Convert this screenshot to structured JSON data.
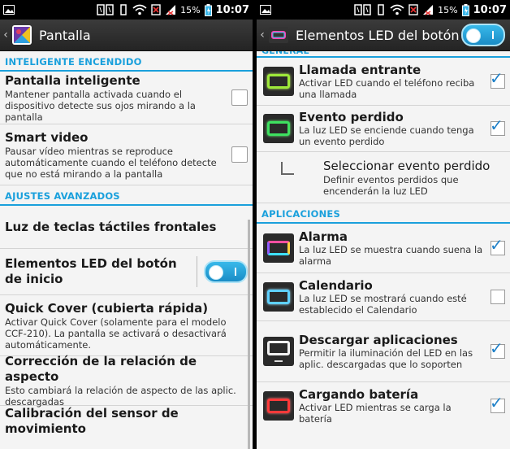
{
  "left": {
    "status": {
      "battery_pct": "15%",
      "time": "10:07"
    },
    "header": {
      "title": "Pantalla"
    },
    "sections": {
      "smart": "INTELIGENTE ENCENDIDO",
      "advanced": "AJUSTES AVANZADOS"
    },
    "items": {
      "smart_screen": {
        "title": "Pantalla inteligente",
        "desc": "Mantener pantalla activada cuando el dispositivo detecte sus ojos mirando a la pantalla"
      },
      "smart_video": {
        "title": "Smart video",
        "desc": "Pausar vídeo mientras se reproduce automáticamente cuando el teléfono detecte que no está mirando a la pantalla"
      },
      "touch_keys": {
        "title": "Luz de teclas táctiles frontales"
      },
      "home_led": {
        "title": "Elementos LED del botón de inicio"
      },
      "quick_cover": {
        "title": "Quick Cover (cubierta rápida)",
        "desc": "Activar Quick Cover (solamente para el modelo CCF-210). La pantalla se activará o desactivará automáticamente."
      },
      "aspect": {
        "title": "Corrección de la relación de aspecto",
        "desc": "Esto cambiará la relación de aspecto de las aplic. descargadas"
      },
      "motion": {
        "title": "Calibración del sensor de movimiento"
      }
    }
  },
  "right": {
    "status": {
      "battery_pct": "15%",
      "time": "10:07"
    },
    "header": {
      "title": "Elementos LED del botón de"
    },
    "sections": {
      "general": "GENERAL",
      "apps": "APLICACIONES"
    },
    "items": {
      "incoming": {
        "title": "Llamada entrante",
        "desc": "Activar LED cuando el teléfono reciba una llamada",
        "checked": true
      },
      "missed": {
        "title": "Evento perdido",
        "desc": "La luz LED se enciende cuando tenga un evento perdido",
        "checked": true
      },
      "select_missed": {
        "title": "Seleccionar evento perdido",
        "desc": "Definir eventos perdidos que encenderán la luz LED"
      },
      "alarm": {
        "title": "Alarma",
        "desc": "La luz LED se muestra cuando suena la alarma",
        "checked": true
      },
      "calendar": {
        "title": "Calendario",
        "desc": "La luz LED se mostrará cuando esté establecido el Calendario",
        "checked": false
      },
      "download": {
        "title": "Descargar aplicaciones",
        "desc": "Permitir la iluminación del LED en las aplic. descargadas que lo soporten",
        "checked": true
      },
      "charging": {
        "title": "Cargando batería",
        "desc": "Activar LED mientras se carga la batería",
        "checked": true
      }
    },
    "tick_glyph": "✓"
  },
  "colors": {
    "accent": "#1aa0dc",
    "battery": "#3bb6e9"
  }
}
